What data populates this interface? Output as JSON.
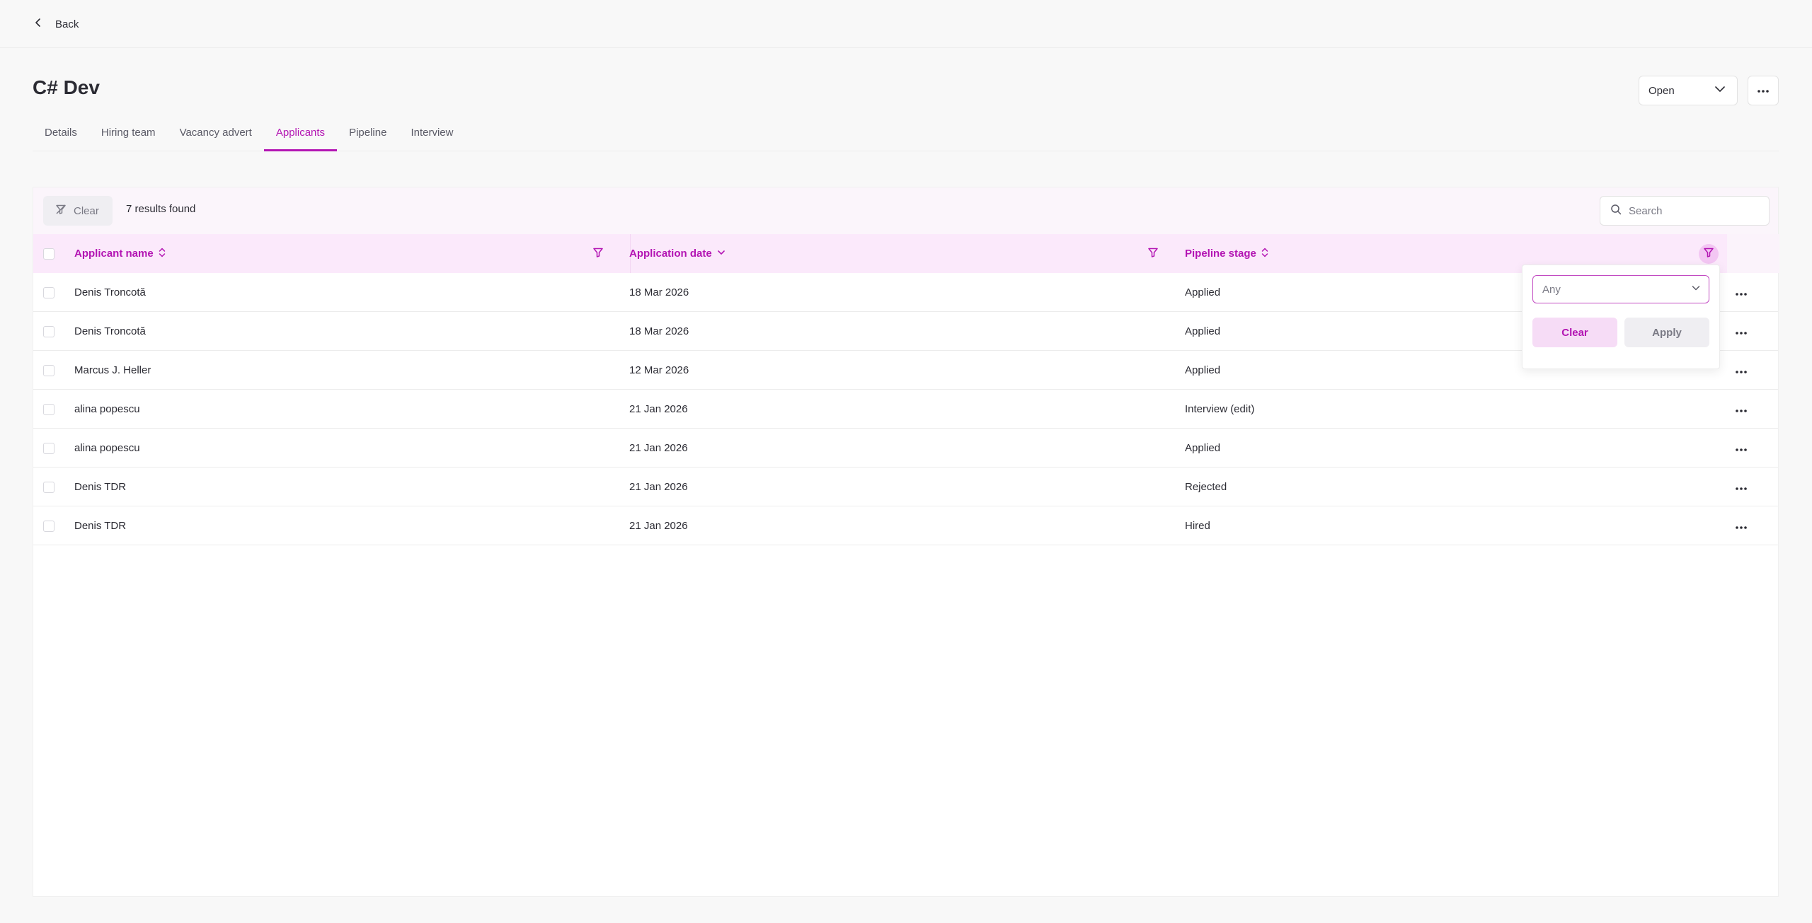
{
  "nav": {
    "back_label": "Back"
  },
  "header": {
    "title": "C# Dev",
    "status_value": "Open"
  },
  "tabs": [
    {
      "label": "Details",
      "active": false
    },
    {
      "label": "Hiring team",
      "active": false
    },
    {
      "label": "Vacancy advert",
      "active": false
    },
    {
      "label": "Applicants",
      "active": true
    },
    {
      "label": "Pipeline",
      "active": false
    },
    {
      "label": "Interview",
      "active": false
    }
  ],
  "toolbar": {
    "clear_label": "Clear",
    "results_text": "7 results found",
    "search_placeholder": "Search"
  },
  "table": {
    "columns": [
      {
        "label": "Applicant name",
        "sort": "both"
      },
      {
        "label": "Application date",
        "sort": "desc"
      },
      {
        "label": "Pipeline stage",
        "sort": "both"
      }
    ],
    "rows": [
      {
        "name": "Denis Troncotă",
        "date": "18 Mar 2026",
        "stage": "Applied"
      },
      {
        "name": "Denis Troncotă",
        "date": "18 Mar 2026",
        "stage": "Applied"
      },
      {
        "name": "Marcus J. Heller",
        "date": "12 Mar 2026",
        "stage": "Applied"
      },
      {
        "name": "alina popescu",
        "date": "21 Jan 2026",
        "stage": "Interview (edit)"
      },
      {
        "name": "alina popescu",
        "date": "21 Jan 2026",
        "stage": "Applied"
      },
      {
        "name": "Denis TDR",
        "date": "21 Jan 2026",
        "stage": "Rejected"
      },
      {
        "name": "Denis TDR",
        "date": "21 Jan 2026",
        "stage": "Hired"
      }
    ]
  },
  "filter_popover": {
    "select_value": "Any",
    "clear_label": "Clear",
    "apply_label": "Apply"
  },
  "colors": {
    "accent": "#b315b3",
    "header_bg": "#fbe9fb",
    "toolbar_bg": "#fbf5fb"
  }
}
